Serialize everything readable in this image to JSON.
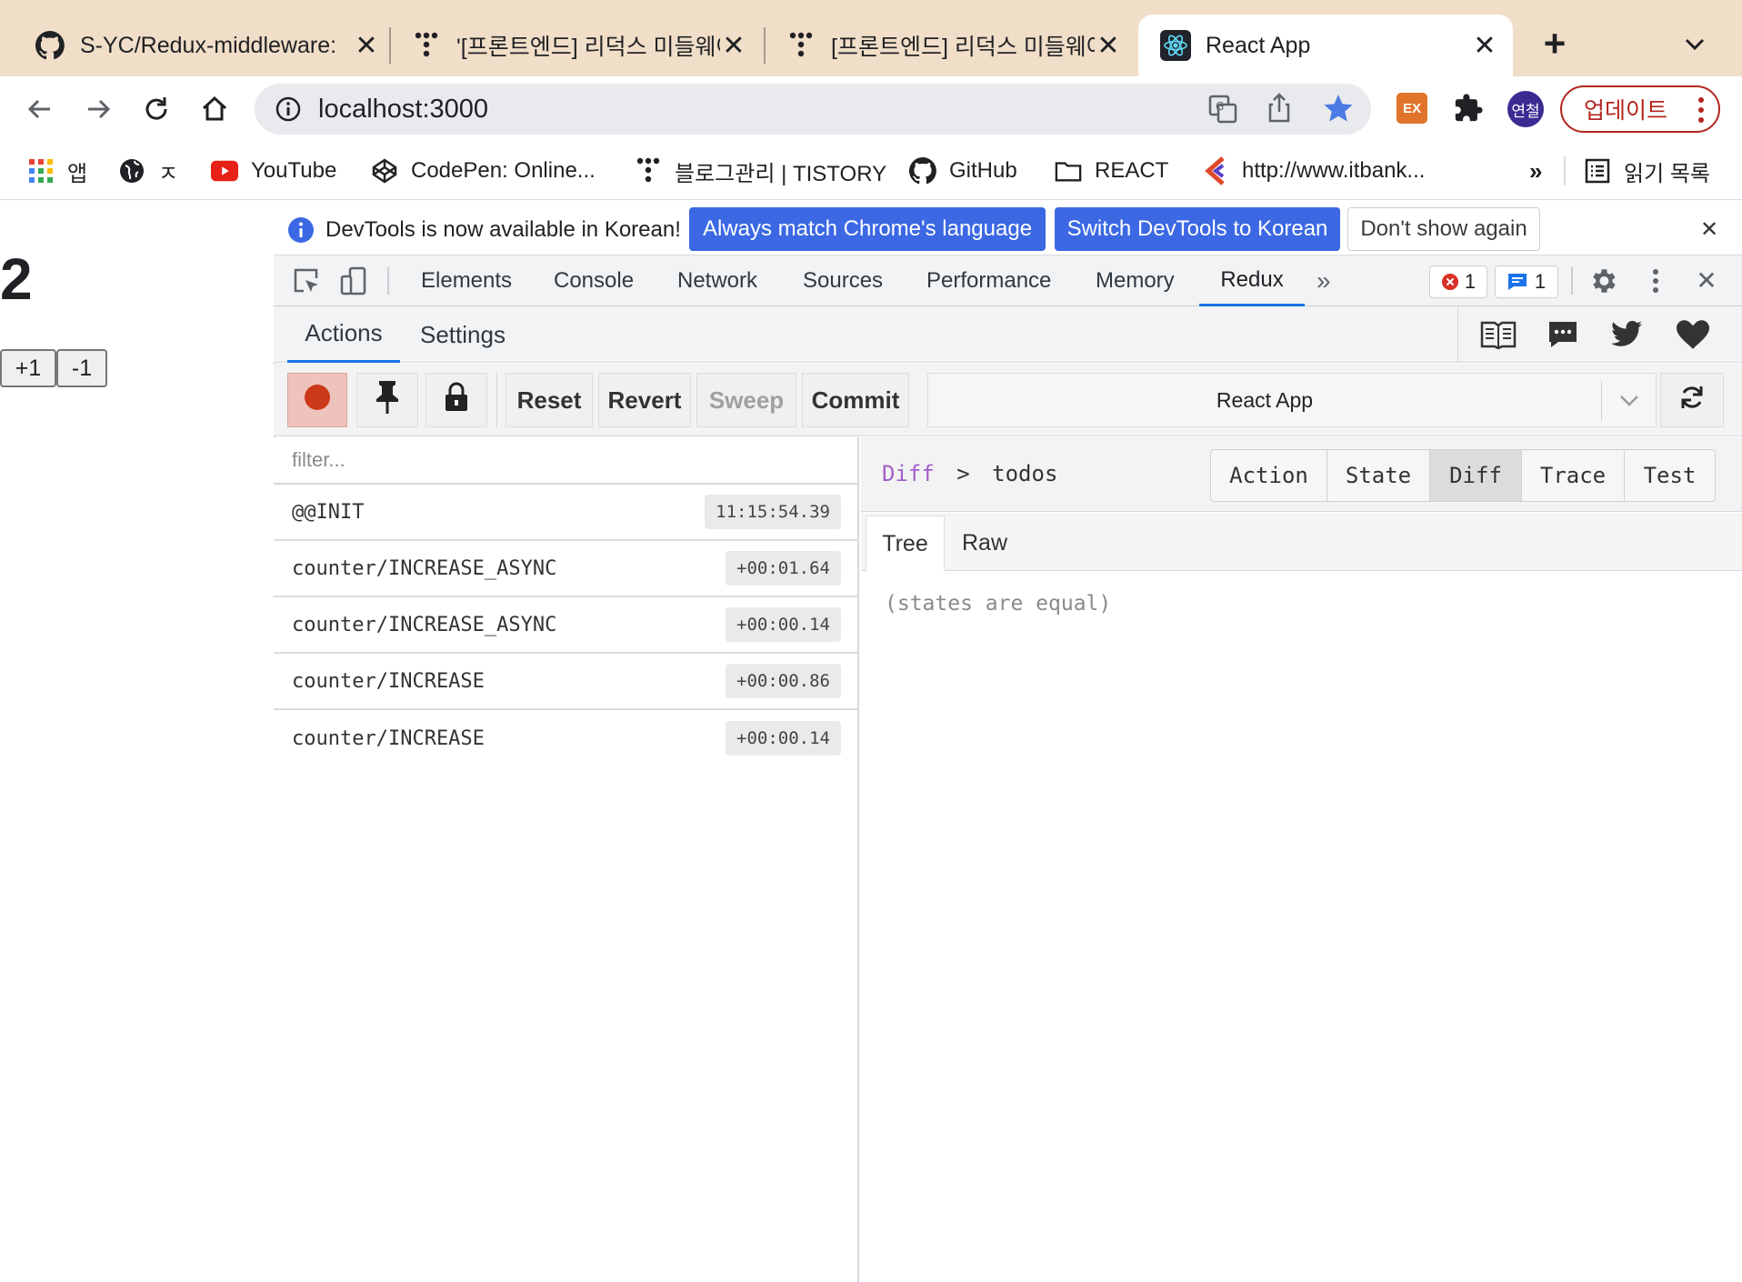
{
  "browser": {
    "tabs": [
      {
        "title": "S-YC/Redux-middleware:",
        "icon": "github-icon"
      },
      {
        "title": "'[프론트엔드] 리덕스 미들웨어",
        "icon": "tistory-icon"
      },
      {
        "title": "[프론트엔드] 리덕스 미들웨어",
        "icon": "tistory-icon"
      },
      {
        "title": "React App",
        "icon": "react-icon"
      }
    ],
    "new_tab_label": "+",
    "tab_list_icon": "chevron-down-icon",
    "url": "localhost:3000",
    "profile_label": "연철",
    "update_label": "업데이트",
    "extension_label": "EX",
    "bookmarks": [
      {
        "label": "앱",
        "icon": "apps-grid-icon"
      },
      {
        "label": "ㅈ",
        "icon": "globe-icon"
      },
      {
        "label": "YouTube",
        "icon": "youtube-icon"
      },
      {
        "label": "CodePen: Online...",
        "icon": "codepen-icon"
      },
      {
        "label": "블로그관리 | TISTORY",
        "icon": "tistory-icon"
      },
      {
        "label": "GitHub",
        "icon": "github-icon"
      },
      {
        "label": "REACT",
        "icon": "folder-icon"
      },
      {
        "label": "http://www.itbank...",
        "icon": "itbank-icon"
      }
    ],
    "more_bookmarks": "»",
    "reading_list": "읽기 목록"
  },
  "app": {
    "counter": "2",
    "inc_label": "+1",
    "dec_label": "-1"
  },
  "devtools": {
    "info_text": "DevTools is now available in Korean!",
    "info_buttons": [
      "Always match Chrome's language",
      "Switch DevTools to Korean",
      "Don't show again"
    ],
    "tabs": [
      "Elements",
      "Console",
      "Network",
      "Sources",
      "Performance",
      "Memory",
      "Redux"
    ],
    "active_tab": "Redux",
    "more_tabs": "»",
    "error_count": "1",
    "message_count": "1"
  },
  "redux": {
    "header_tabs": [
      "Actions",
      "Settings"
    ],
    "toolbar_buttons": [
      "Reset",
      "Revert",
      "Sweep",
      "Commit"
    ],
    "instance": "React App",
    "filter_placeholder": "filter...",
    "actions": [
      {
        "type": "@@INIT",
        "time": "11:15:54.39"
      },
      {
        "type": "counter/INCREASE_ASYNC",
        "time": "+00:01.64"
      },
      {
        "type": "counter/INCREASE_ASYNC",
        "time": "+00:00.14"
      },
      {
        "type": "counter/INCREASE",
        "time": "+00:00.86"
      },
      {
        "type": "counter/INCREASE",
        "time": "+00:00.14"
      }
    ],
    "breadcrumb_root": "Diff",
    "breadcrumb_sep": ">",
    "breadcrumb_leaf": "todos",
    "monitor_tabs": [
      "Action",
      "State",
      "Diff",
      "Trace",
      "Test"
    ],
    "selected_monitor": "Diff",
    "sub_tabs": [
      "Tree",
      "Raw"
    ],
    "diff_message": "(states are equal)",
    "colors": {
      "record": "#cc3a1a",
      "link_blue": "#1a73e8",
      "active_blue": "#3c68e4",
      "diff_purple": "#a35ec9"
    }
  }
}
